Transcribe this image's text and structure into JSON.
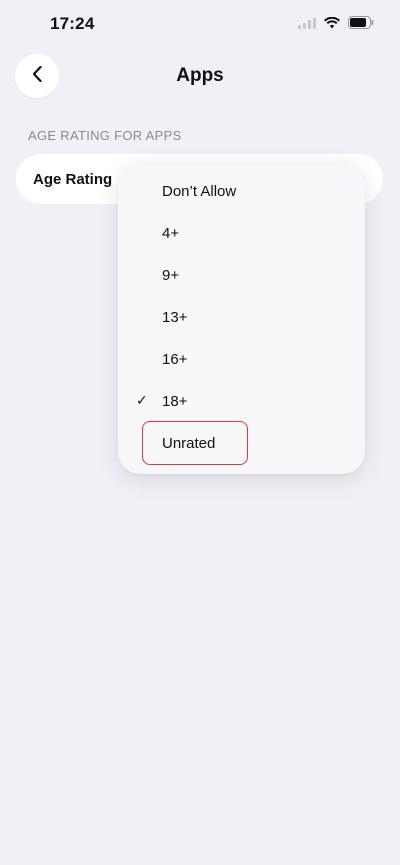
{
  "status_bar": {
    "time": "17:24",
    "icons": [
      "signal-icon",
      "wifi-icon",
      "battery-icon"
    ]
  },
  "header": {
    "title": "Apps",
    "back_icon": "chevron-left-icon"
  },
  "section": {
    "label": "AGE RATING FOR APPS"
  },
  "setting_row": {
    "label": "Age Rating"
  },
  "dropdown": {
    "items": [
      {
        "label": "Don’t Allow",
        "checked": false
      },
      {
        "label": "4+",
        "checked": false
      },
      {
        "label": "9+",
        "checked": false
      },
      {
        "label": "13+",
        "checked": false
      },
      {
        "label": "16+",
        "checked": false
      },
      {
        "label": "18+",
        "checked": true,
        "check_mark": "✓"
      },
      {
        "label": "Unrated",
        "checked": false
      }
    ],
    "highlighted_item": "Unrated",
    "highlight_color": "#e03a3a"
  },
  "colors": {
    "background": "#f1f0f6",
    "card": "#ffffff",
    "menu": "#f7f7f9",
    "secondary_text": "#8a8a90"
  }
}
